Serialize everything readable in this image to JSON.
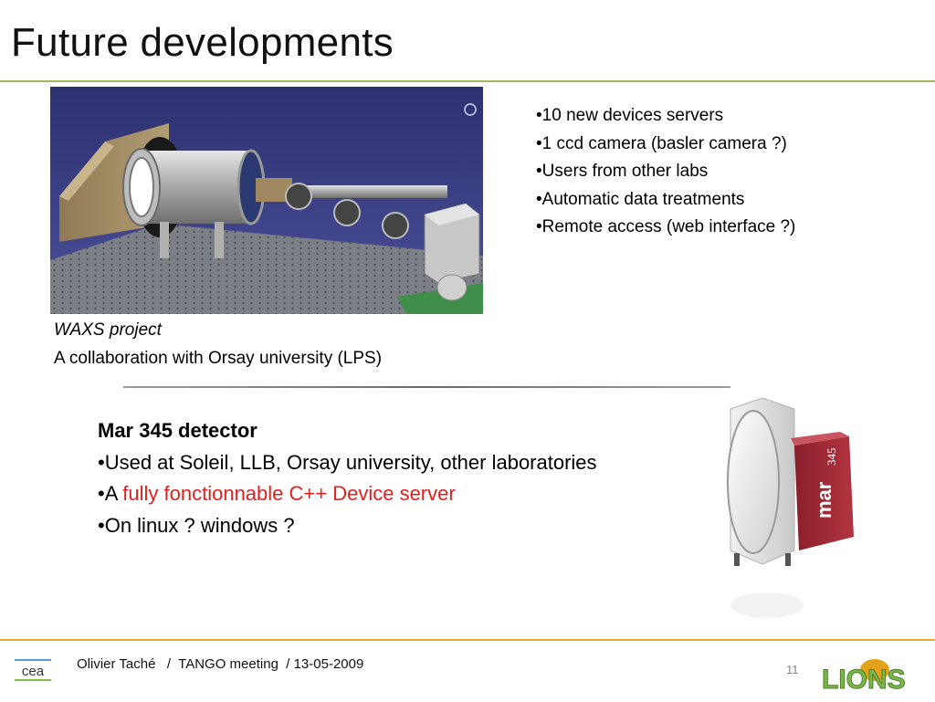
{
  "slide": {
    "title": "Future developments"
  },
  "waxs": {
    "caption_italic": "WAXS project",
    "caption": "A collaboration with Orsay university (LPS)"
  },
  "top_bullets": [
    "•10 new devices servers",
    "•1 ccd camera (basler camera ?)",
    "•Users from other labs",
    "•Automatic data treatments",
    "•Remote access (web interface ?)"
  ],
  "mar": {
    "heading": "Mar 345 detector",
    "bullet1": "•Used at Soleil, LLB, Orsay university, other laboratories",
    "bullet2_prefix": "•A ",
    "bullet2_red": "fully fonctionnable C++ Device server",
    "bullet3": "•On linux ? windows ?",
    "device_label": "mar",
    "device_model": "345"
  },
  "footer": {
    "author_line": "Olivier Taché   /  TANGO meeting  / 13-05-2009",
    "page_number": "11",
    "left_logo_text": "cea",
    "right_logo_text": "LIONS"
  },
  "colors": {
    "title_rule": "#9bbb59",
    "footer_rule": "#f0a830",
    "highlight_red": "#e0201e",
    "render_background": "#3a3f7e"
  }
}
